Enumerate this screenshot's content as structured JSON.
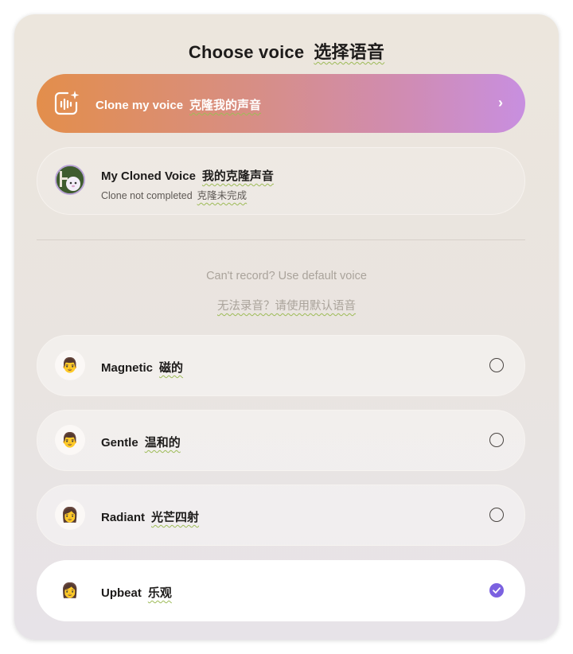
{
  "title": {
    "en": "Choose voice",
    "cn": "选择语音"
  },
  "clone": {
    "label_en": "Clone my voice",
    "label_cn": "克隆我的声音",
    "icon": "voice-waveform-sparkle-icon",
    "chevron": "›"
  },
  "cloned_voice": {
    "name_en": "My Cloned Voice",
    "name_cn": "我的克隆声音",
    "status_en": "Clone not completed",
    "status_cn": "克隆未完成",
    "avatar": "cartoon-avatar-icon"
  },
  "default_hint": {
    "en": "Can't record? Use default voice",
    "cn": "无法录音？请使用默认语音"
  },
  "voices": [
    {
      "emoji": "👨",
      "name_en": "Magnetic",
      "name_cn": "磁的",
      "selected": false
    },
    {
      "emoji": "👨",
      "name_en": "Gentle",
      "name_cn": "温和的",
      "selected": false
    },
    {
      "emoji": "👩",
      "name_en": "Radiant",
      "name_cn": "光芒四射",
      "selected": false
    },
    {
      "emoji": "👩",
      "name_en": "Upbeat",
      "name_cn": "乐观",
      "selected": true
    }
  ],
  "colors": {
    "accent": "#7b61e0",
    "gradient_start": "#e38e4b",
    "gradient_end": "#c88fe0"
  }
}
